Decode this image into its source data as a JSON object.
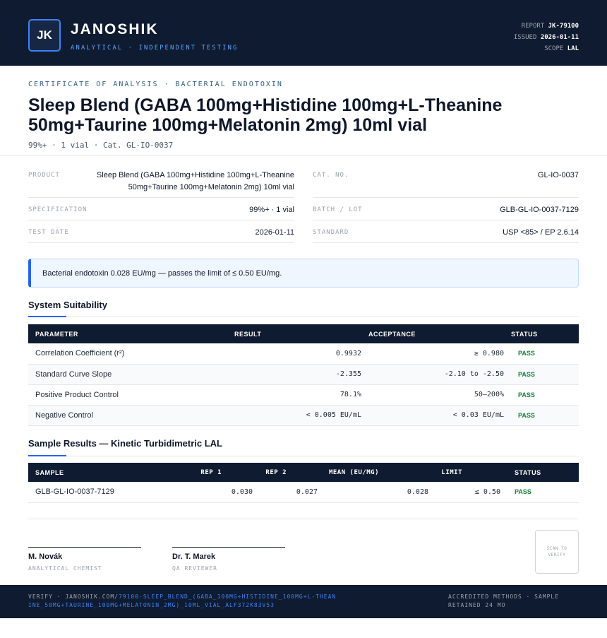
{
  "header": {
    "logo_text": "JK",
    "brand": "JANOSHIK",
    "tagline": "ANALYTICAL · INDEPENDENT TESTING",
    "report_label": "REPORT",
    "report_value": "JK-79100",
    "issued_label": "ISSUED",
    "issued_value": "2026-01-11",
    "scope_label": "SCOPE",
    "scope_value": "LAL"
  },
  "title_block": {
    "kicker": "CERTIFICATE OF ANALYSIS · BACTERIAL ENDOTOXIN",
    "title": "Sleep Blend (GABA 100mg+Histidine 100mg+L-Theanine 50mg+Taurine 100mg+Melatonin 2mg) 10ml vial",
    "subline": "99%+ · 1 vial  ·  Cat. GL-IO-0037"
  },
  "info": {
    "product_label": "PRODUCT",
    "product_value": "Sleep Blend (GABA 100mg+Histidine 100mg+L-Theanine 50mg+Taurine 100mg+Melatonin 2mg) 10ml vial",
    "catno_label": "CAT. NO.",
    "catno_value": "GL-IO-0037",
    "spec_label": "SPECIFICATION",
    "spec_value": "99%+ · 1 vial",
    "batch_label": "BATCH / LOT",
    "batch_value": "GLB-GL-IO-0037-7129",
    "date_label": "TEST DATE",
    "date_value": "2026-01-11",
    "standard_label": "STANDARD",
    "standard_value": "USP <85> / EP 2.6.14"
  },
  "callout": "Bacterial endotoxin 0.028 EU/mg — passes the limit of ≤ 0.50 EU/mg.",
  "suitability": {
    "title": "System Suitability",
    "headers": [
      "PARAMETER",
      "RESULT",
      "ACCEPTANCE",
      "STATUS"
    ],
    "rows": [
      {
        "param": "Correlation Coefficient (r²)",
        "result": "0.9932",
        "acceptance": "≥ 0.980",
        "status": "PASS"
      },
      {
        "param": "Standard Curve Slope",
        "result": "-2.355",
        "acceptance": "-2.10 to -2.50",
        "status": "PASS"
      },
      {
        "param": "Positive Product Control",
        "result": "78.1%",
        "acceptance": "50–200%",
        "status": "PASS"
      },
      {
        "param": "Negative Control",
        "result": "< 0.005 EU/mL",
        "acceptance": "< 0.03 EU/mL",
        "status": "PASS"
      }
    ]
  },
  "samples": {
    "title": "Sample Results — Kinetic Turbidimetric LAL",
    "headers": [
      "SAMPLE",
      "REP 1",
      "REP 2",
      "MEAN (EU/MG)",
      "LIMIT",
      "STATUS"
    ],
    "rows": [
      {
        "sample": "GLB-GL-IO-0037-7129",
        "rep1": "0.030",
        "rep2": "0.027",
        "mean": "0.028",
        "limit": "≤ 0.50",
        "status": "PASS"
      }
    ]
  },
  "signatures": [
    {
      "name": "M. Novák",
      "role": "ANALYTICAL CHEMIST"
    },
    {
      "name": "Dr. T. Marek",
      "role": "QA REVIEWER"
    }
  ],
  "qr_text": "SCAN TO VERIFY",
  "footer": {
    "verify_prefix": "VERIFY · JANOSHIK.COM/",
    "verify_path": "79100-SLEEP_BLEND_(GABA_100MG+HISTIDINE_100MG+L-THEANINE_50MG+TAURINE_100MG+MELATONIN_2MG)_10ML_VIAL_ALF372K83V53",
    "right": "ACCREDITED METHODS · SAMPLE RETAINED 24 MO"
  }
}
